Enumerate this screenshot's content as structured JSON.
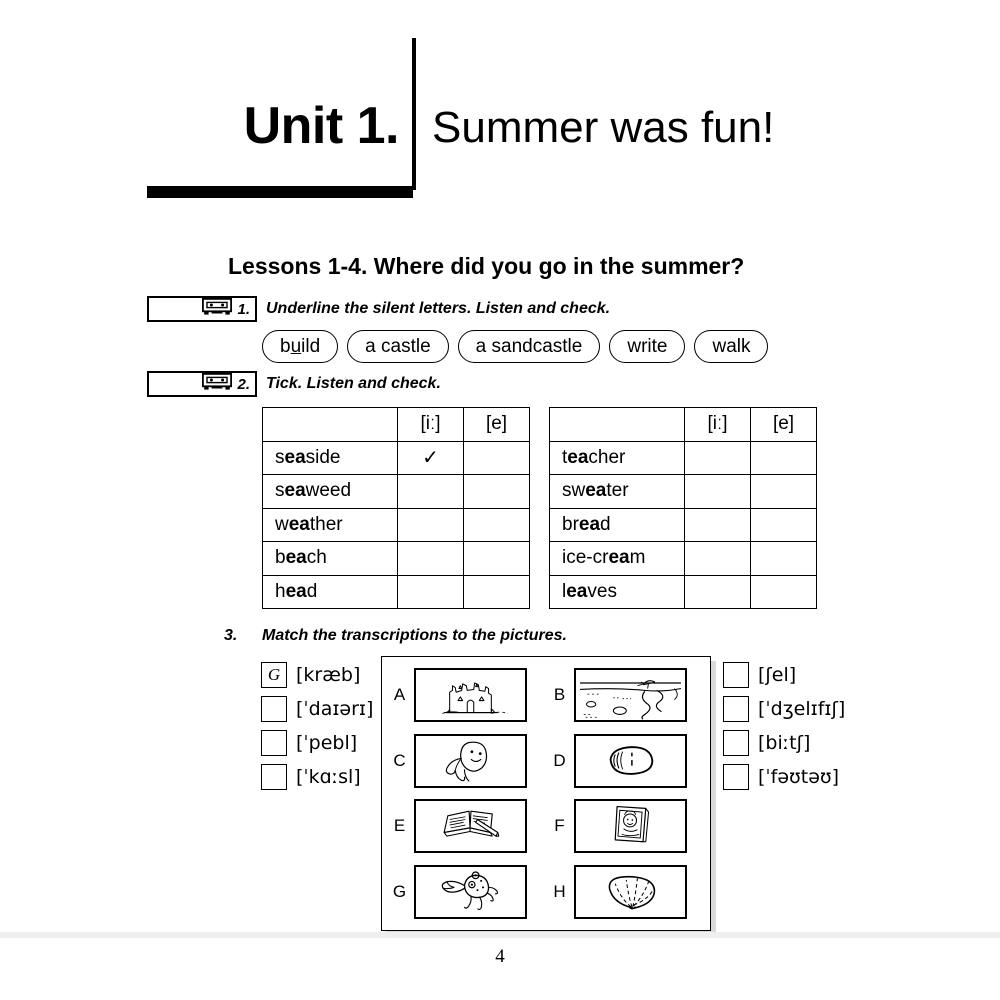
{
  "unit": {
    "label": "Unit 1.",
    "subject": "Summer was fun!"
  },
  "lessons_heading": "Lessons 1-4. Where did you go in the summer?",
  "exercises": [
    {
      "number": "1.",
      "icon": "cassette-icon",
      "instruction": "Underline the silent letters. Listen and check.",
      "pills": [
        {
          "prefix": "b",
          "underlined": "u",
          "suffix": "ild",
          "full": "build"
        },
        {
          "prefix": "a castle",
          "underlined": "",
          "suffix": "",
          "full": "a castle"
        },
        {
          "prefix": "a sandcastle",
          "underlined": "",
          "suffix": "",
          "full": "a sandcastle"
        },
        {
          "prefix": "write",
          "underlined": "",
          "suffix": "",
          "full": "write"
        },
        {
          "prefix": "walk",
          "underlined": "",
          "suffix": "",
          "full": "walk"
        }
      ]
    },
    {
      "number": "2.",
      "icon": "cassette-icon",
      "instruction": "Tick. Listen and check.",
      "tables": [
        {
          "headers": [
            "",
            "[iː]",
            "[e]"
          ],
          "rows": [
            {
              "pre": "s",
              "bold": "ea",
              "post": "side",
              "word": "seaside",
              "tick_i": "✓",
              "tick_e": ""
            },
            {
              "pre": "s",
              "bold": "ea",
              "post": "weed",
              "word": "seaweed",
              "tick_i": "",
              "tick_e": ""
            },
            {
              "pre": "w",
              "bold": "ea",
              "post": "ther",
              "word": "weather",
              "tick_i": "",
              "tick_e": ""
            },
            {
              "pre": "b",
              "bold": "ea",
              "post": "ch",
              "word": "beach",
              "tick_i": "",
              "tick_e": ""
            },
            {
              "pre": "h",
              "bold": "ea",
              "post": "d",
              "word": "head",
              "tick_i": "",
              "tick_e": ""
            }
          ]
        },
        {
          "headers": [
            "",
            "[iː]",
            "[e]"
          ],
          "rows": [
            {
              "pre": "t",
              "bold": "ea",
              "post": "cher",
              "word": "teacher",
              "tick_i": "",
              "tick_e": ""
            },
            {
              "pre": "sw",
              "bold": "ea",
              "post": "ter",
              "word": "sweater",
              "tick_i": "",
              "tick_e": ""
            },
            {
              "pre": "br",
              "bold": "ea",
              "post": "d",
              "word": "bread",
              "tick_i": "",
              "tick_e": ""
            },
            {
              "pre": "ice-cr",
              "bold": "ea",
              "post": "m",
              "word": "ice-cream",
              "tick_i": "",
              "tick_e": ""
            },
            {
              "pre": "l",
              "bold": "ea",
              "post": "ves",
              "word": "leaves",
              "tick_i": "",
              "tick_e": ""
            }
          ]
        }
      ]
    },
    {
      "number": "3.",
      "instruction": "Match the transcriptions to the pictures.",
      "transcriptions_left": [
        {
          "answer": "G",
          "text": "[kræb]"
        },
        {
          "answer": "",
          "text": "[ˈdaɪərɪ]"
        },
        {
          "answer": "",
          "text": "[ˈpebl]"
        },
        {
          "answer": "",
          "text": "[ˈkɑːsl]"
        }
      ],
      "transcriptions_right": [
        {
          "answer": "",
          "text": "[ʃel]"
        },
        {
          "answer": "",
          "text": "[ˈdʒelɪfɪʃ]"
        },
        {
          "answer": "",
          "text": "[biːtʃ]"
        },
        {
          "answer": "",
          "text": "[ˈfəʊtəʊ]"
        }
      ],
      "pictures": [
        {
          "letter": "A",
          "image": "sandcastle-picture"
        },
        {
          "letter": "B",
          "image": "beach-picture"
        },
        {
          "letter": "C",
          "image": "jellyfish-picture"
        },
        {
          "letter": "D",
          "image": "pebble-picture"
        },
        {
          "letter": "E",
          "image": "diary-picture"
        },
        {
          "letter": "F",
          "image": "photo-picture"
        },
        {
          "letter": "G",
          "image": "crab-picture"
        },
        {
          "letter": "H",
          "image": "shell-picture"
        }
      ]
    }
  ],
  "page_number": "4",
  "colors": {
    "ink": "#000000",
    "paper": "#ffffff",
    "shadow": "#d9d9d9"
  }
}
